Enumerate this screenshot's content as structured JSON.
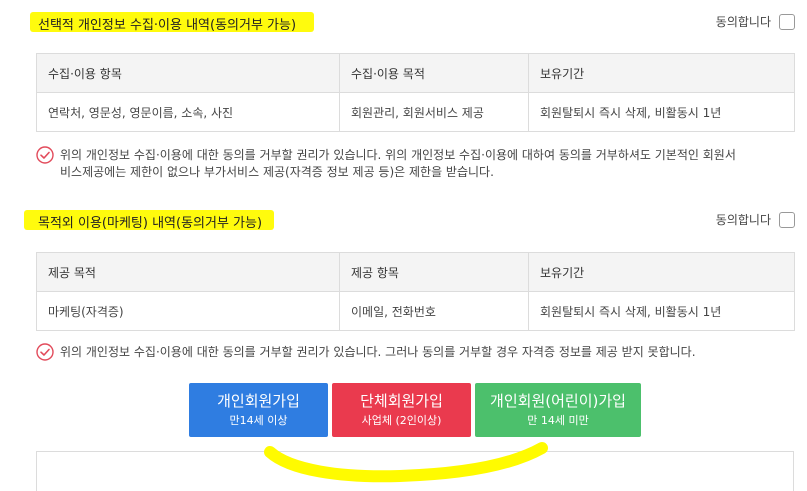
{
  "section1": {
    "title": "선택적 개인정보 수집·이용 내역(동의거부 가능)",
    "agree_label": "동의합니다",
    "table": {
      "headers": [
        "수집·이용 항목",
        "수집·이용 목적",
        "보유기간"
      ],
      "row": [
        "연락처, 영문성, 영문이름, 소속, 사진",
        "회원관리, 회원서비스 제공",
        "회원탈퇴시 즉시 삭제, 비활동시 1년"
      ]
    },
    "notice_line1": "위의 개인정보 수집·이용에 대한 동의를 거부할 권리가 있습니다. 위의 개인정보 수집·이용에 대하여 동의를 거부하셔도 기본적인 회원서",
    "notice_line2": "비스제공에는 제한이 없으나 부가서비스 제공(자격증 정보 제공 등)은 제한을 받습니다."
  },
  "section2": {
    "title": "목적외 이용(마케팅) 내역(동의거부 가능)",
    "agree_label": "동의합니다",
    "table": {
      "headers": [
        "제공 목적",
        "제공 항목",
        "보유기간"
      ],
      "row": [
        "마케팅(자격증)",
        "이메일, 전화번호",
        "회원탈퇴시 즉시 삭제, 비활동시 1년"
      ]
    },
    "notice": "위의 개인정보 수집·이용에 대한 동의를 거부할 권리가 있습니다. 그러나 동의를 거부할 경우 자격증 정보를 제공 받지 못합니다."
  },
  "buttons": [
    {
      "label": "개인회원가입",
      "sub": "만14세 이상",
      "color": "#2f7de1"
    },
    {
      "label": "단체회원가입",
      "sub": "사업체 (2인이상)",
      "color": "#ea3a4e"
    },
    {
      "label": "개인회원(어린이)가입",
      "sub": "만 14세 미만",
      "color": "#4cc06c"
    }
  ],
  "colors": {
    "highlight": "#fffb00",
    "check_icon": "#e24b5b"
  },
  "icons": [
    "check-circle-icon",
    "checkbox"
  ]
}
